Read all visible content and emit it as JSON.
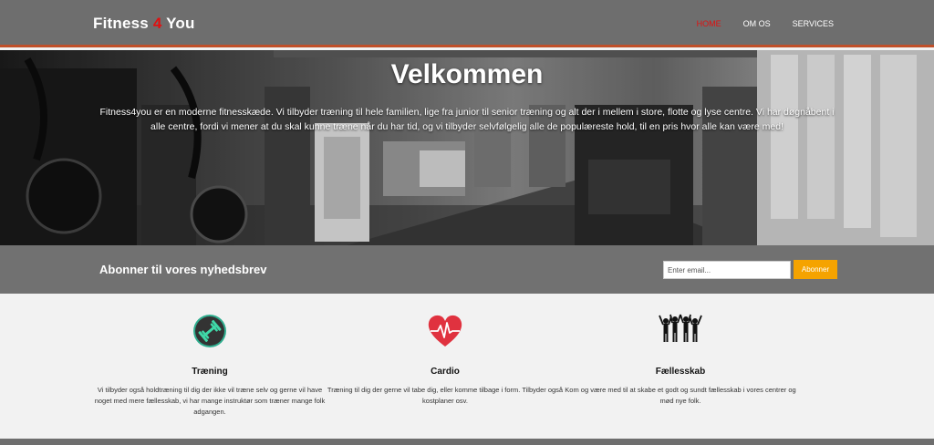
{
  "header": {
    "logo_part1": "Fitness ",
    "logo_accent": "4",
    "logo_part2": " You",
    "nav": [
      {
        "label": "HOME",
        "active": true
      },
      {
        "label": "OM OS",
        "active": false
      },
      {
        "label": "SERVICES",
        "active": false
      }
    ]
  },
  "hero": {
    "title": "Velkommen",
    "text": "Fitness4you er en moderne fitnesskæde. Vi tilbyder træning til hele familien, lige fra junior til senior træning og alt der i mellem i store, flotte og lyse centre. Vi har døgnåbent i alle centre, fordi vi mener at du skal kunne træne når du har tid, og vi tilbyder selvfølgelig alle de populæreste hold, til en pris hvor alle kan være med!"
  },
  "newsletter": {
    "title": "Abonner til vores nyhedsbrev",
    "email_placeholder": "Enter email...",
    "button_label": "Abonner"
  },
  "features": [
    {
      "icon": "dumbbell-icon",
      "title": "Træning",
      "text": "Vi tilbyder også holdtræning til dig der ikke vil træne selv og gerne vil have noget med mere fællesskab, vi har mange instruktør som træner mange folk adgangen."
    },
    {
      "icon": "heartbeat-icon",
      "title": "Cardio",
      "text": "Træning til dig der gerne vil tabe dig, eller komme tilbage i form. Tilbyder også kostplaner osv."
    },
    {
      "icon": "community-icon",
      "title": "Fællesskab",
      "text": "Kom og være med til at skabe et godt og sundt fællesskab i vores centrer og mød nye folk."
    }
  ],
  "colors": {
    "header_bg": "#6e6e6e",
    "accent_red": "#e01010",
    "header_border": "#c0502a",
    "button_orange": "#f5a300",
    "newsletter_bg": "#717171"
  }
}
